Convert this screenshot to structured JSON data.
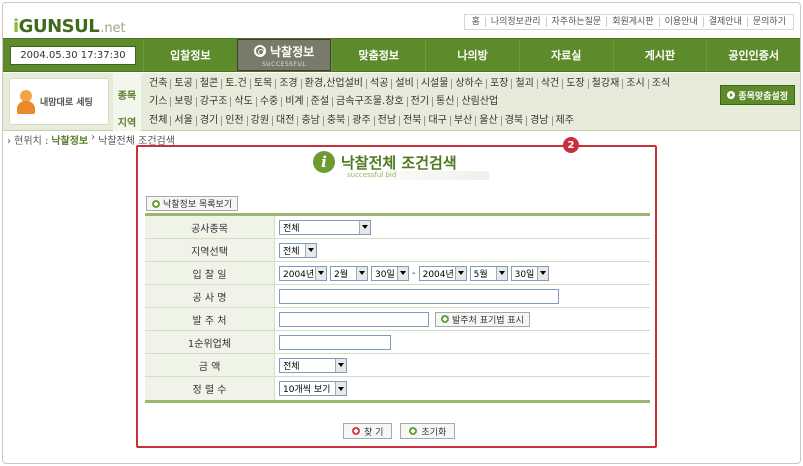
{
  "logo": {
    "part1": "i",
    "part2": "GUNSUL",
    "net": ".net"
  },
  "toplinks": [
    "홈",
    "나의정보관리",
    "자주하는질문",
    "회원게시판",
    "이용안내",
    "결제안내",
    "문의하기"
  ],
  "nav": {
    "datetime": "2004.05.30 17:37:30",
    "items": [
      "입찰정보",
      "낙찰정보",
      "맞춤정보",
      "나의방",
      "자료실",
      "게시판",
      "공인인증서"
    ],
    "active_sub": "SUCCESSFUL"
  },
  "category": {
    "custom_label": "내맘대로 세팅",
    "type_label": "종목",
    "region_label": "지역",
    "row1": [
      "건축",
      "토공",
      "철콘",
      "토.건",
      "토목",
      "조경",
      "환경,산업설비",
      "석공",
      "설비",
      "시설물",
      "상하수",
      "포장",
      "철괴",
      "삭건",
      "도장",
      "철강재",
      "조시",
      "조식"
    ],
    "row2": [
      "기스",
      "보링",
      "강구조",
      "삭도",
      "수중",
      "비계",
      "준설",
      "금속구조물.창호",
      "전기",
      "통신",
      "산림산업"
    ],
    "row3": [
      "전체",
      "서울",
      "경기",
      "인천",
      "강원",
      "대전",
      "충남",
      "충북",
      "광주",
      "전남",
      "전북",
      "대구",
      "부산",
      "울산",
      "경북",
      "경남",
      "제주"
    ],
    "set_button": "종목맞춤설정"
  },
  "breadcrumb": {
    "prefix": "› 현위치 :",
    "section": "낙찰정보",
    "sep": "›",
    "current": "낙찰전체 조건검색"
  },
  "annotation_badge": "2",
  "page": {
    "title": "낙찰전체 조건검색",
    "subtitle": "successful bid",
    "list_button": "낙찰정보 목록보기"
  },
  "form": {
    "labels": {
      "type": "공사종목",
      "region": "지역선택",
      "date": "입 찰 일",
      "name": "공 사 명",
      "client": "발 주 처",
      "winner": "1순위업체",
      "amount": "금  액",
      "sort": "정 렬 수"
    },
    "type_value": "전체",
    "region_value": "전체",
    "date_from": {
      "year": "2004년",
      "month": "2월",
      "day": "30일"
    },
    "date_sep": "-",
    "date_to": {
      "year": "2004년",
      "month": "5월",
      "day": "30일"
    },
    "name_value": "",
    "client_value": "",
    "client_button": "발주처 표기법 표시",
    "winner_value": "",
    "amount_value": "전체",
    "sort_value": "10개씩 보기"
  },
  "actions": {
    "search": "찾 기",
    "reset": "초기화"
  },
  "colors": {
    "primary_green": "#5d8a2a",
    "annotation_red": "#c8303c"
  }
}
